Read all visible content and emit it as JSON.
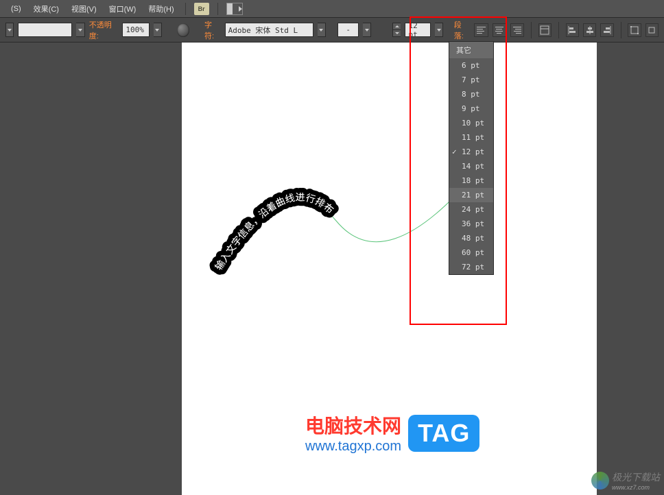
{
  "menubar": {
    "items": [
      "(S)",
      "效果(C)",
      "视图(V)",
      "窗口(W)",
      "帮助(H)"
    ],
    "br": "Br"
  },
  "toolbar": {
    "opacity_label": "不透明度:",
    "opacity_value": "100%",
    "char_label": "字符:",
    "font_value": "Adobe 宋体 Std L",
    "weight_value": "-",
    "size_value": "12 pt",
    "para_label": "段落:"
  },
  "size_dropdown": {
    "header": "其它",
    "options": [
      "6 pt",
      "7 pt",
      "8 pt",
      "9 pt",
      "10 pt",
      "11 pt",
      "12 pt",
      "14 pt",
      "18 pt",
      "21 pt",
      "24 pt",
      "36 pt",
      "48 pt",
      "60 pt",
      "72 pt"
    ],
    "selected": "12 pt",
    "hovered": "21 pt"
  },
  "canvas": {
    "path_text": "输入文字信息，沿着曲线进行排布"
  },
  "watermarks": {
    "title": "电脑技术网",
    "url": "www.tagxp.com",
    "tag": "TAG",
    "site2": "极光下载站",
    "site2_sub": "www.xz7.com"
  }
}
